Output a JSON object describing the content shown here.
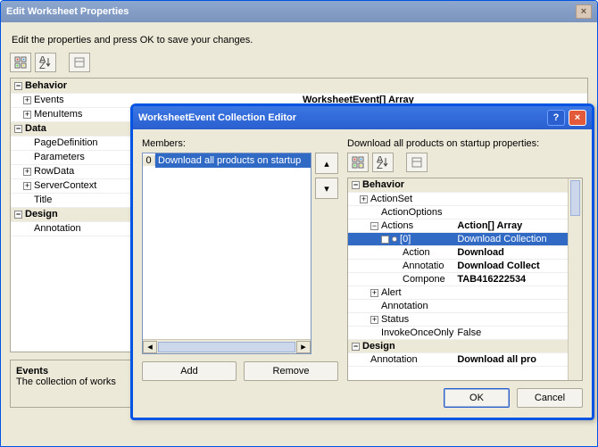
{
  "outer": {
    "title": "Edit Worksheet Properties",
    "close_glyph": "×",
    "instruction": "Edit the properties and press OK to save your changes.",
    "categories": [
      {
        "name": "Behavior",
        "expanded": true,
        "items": [
          {
            "name": "Events",
            "value": "WorksheetEvent[] Array",
            "bold": true,
            "exp": "+"
          },
          {
            "name": "MenuItems",
            "value": "",
            "exp": "+"
          }
        ]
      },
      {
        "name": "Data",
        "expanded": true,
        "items": [
          {
            "name": "PageDefinition",
            "value": ""
          },
          {
            "name": "Parameters",
            "value": ""
          },
          {
            "name": "RowData",
            "value": "",
            "exp": "+"
          },
          {
            "name": "ServerContext",
            "value": "",
            "exp": "+"
          },
          {
            "name": "Title",
            "value": ""
          }
        ]
      },
      {
        "name": "Design",
        "expanded": true,
        "items": [
          {
            "name": "Annotation",
            "value": ""
          }
        ]
      }
    ],
    "desc": {
      "title": "Events",
      "text": "The collection of works"
    }
  },
  "inner": {
    "title": "WorksheetEvent Collection Editor",
    "help_glyph": "?",
    "close_glyph": "×",
    "members_label": "Members:",
    "members": [
      {
        "idx": "0",
        "label": "Download all products on startup"
      }
    ],
    "up_glyph": "▴",
    "down_glyph": "▾",
    "left_glyph": "◂",
    "right_glyph": "▸",
    "add_label": "Add",
    "remove_label": "Remove",
    "props_label": "Download all products on startup properties:",
    "prop_rows": [
      {
        "type": "cat",
        "name": "Behavior"
      },
      {
        "type": "row",
        "exp": "+",
        "indent": 0,
        "name": "ActionSet",
        "val": ""
      },
      {
        "type": "row",
        "indent": 1,
        "name": "ActionOptions",
        "val": ""
      },
      {
        "type": "row",
        "exp": "−",
        "indent": 1,
        "name": "Actions",
        "val": "Action[] Array",
        "bold": true
      },
      {
        "type": "row",
        "exp": "−",
        "indent": 2,
        "name": "[0]",
        "val": "Download Collection",
        "sel": true,
        "normal": true
      },
      {
        "type": "row",
        "indent": 3,
        "name": "Action",
        "val": "Download",
        "bold": true
      },
      {
        "type": "row",
        "indent": 3,
        "name": "Annotatio",
        "val": "Download Collect",
        "bold": true
      },
      {
        "type": "row",
        "indent": 3,
        "name": "Compone",
        "val": "TAB416222534",
        "bold": true
      },
      {
        "type": "row",
        "exp": "+",
        "indent": 1,
        "name": "Alert",
        "val": ""
      },
      {
        "type": "row",
        "indent": 1,
        "name": "Annotation",
        "val": ""
      },
      {
        "type": "row",
        "exp": "+",
        "indent": 1,
        "name": "Status",
        "val": ""
      },
      {
        "type": "row",
        "indent": 1,
        "name": "InvokeOnceOnly",
        "val": "False",
        "normal": true
      },
      {
        "type": "cat",
        "name": "Design"
      },
      {
        "type": "row",
        "indent": 0,
        "name": "Annotation",
        "val": "Download all pro",
        "bold": true
      }
    ],
    "ok_label": "OK",
    "cancel_label": "Cancel"
  }
}
